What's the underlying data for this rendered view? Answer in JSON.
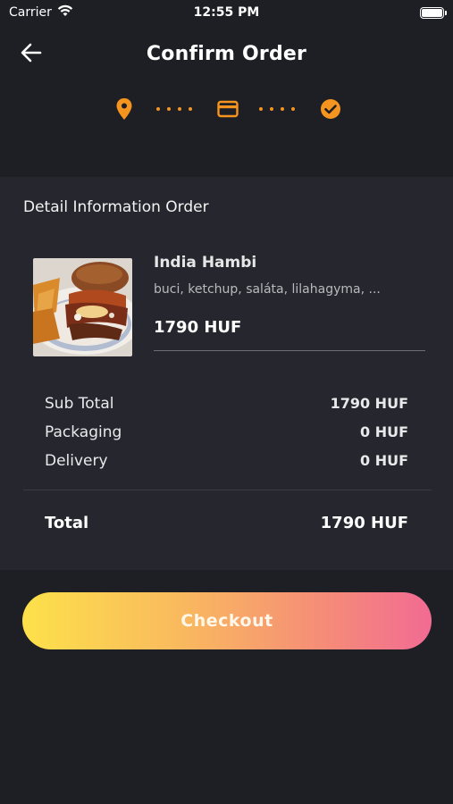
{
  "status_bar": {
    "carrier": "Carrier",
    "time": "12:55 PM"
  },
  "header": {
    "title": "Confirm Order",
    "steps": [
      {
        "icon": "location-pin-icon"
      },
      {
        "icon": "credit-card-icon"
      },
      {
        "icon": "check-circle-icon"
      }
    ],
    "accent_color": "#f5941f"
  },
  "order": {
    "section_title": "Detail Information Order",
    "item": {
      "name": "India Hambi",
      "description": "buci, ketchup, saláta, lilahagyma, ...",
      "price": "1790 HUF"
    },
    "summary": [
      {
        "label": "Sub Total",
        "value": "1790 HUF"
      },
      {
        "label": "Packaging",
        "value": "0 HUF"
      },
      {
        "label": "Delivery",
        "value": "0 HUF"
      }
    ],
    "total": {
      "label": "Total",
      "value": "1790 HUF"
    }
  },
  "checkout": {
    "label": "Checkout",
    "gradient": [
      "#fde14a",
      "#f26b93"
    ]
  }
}
